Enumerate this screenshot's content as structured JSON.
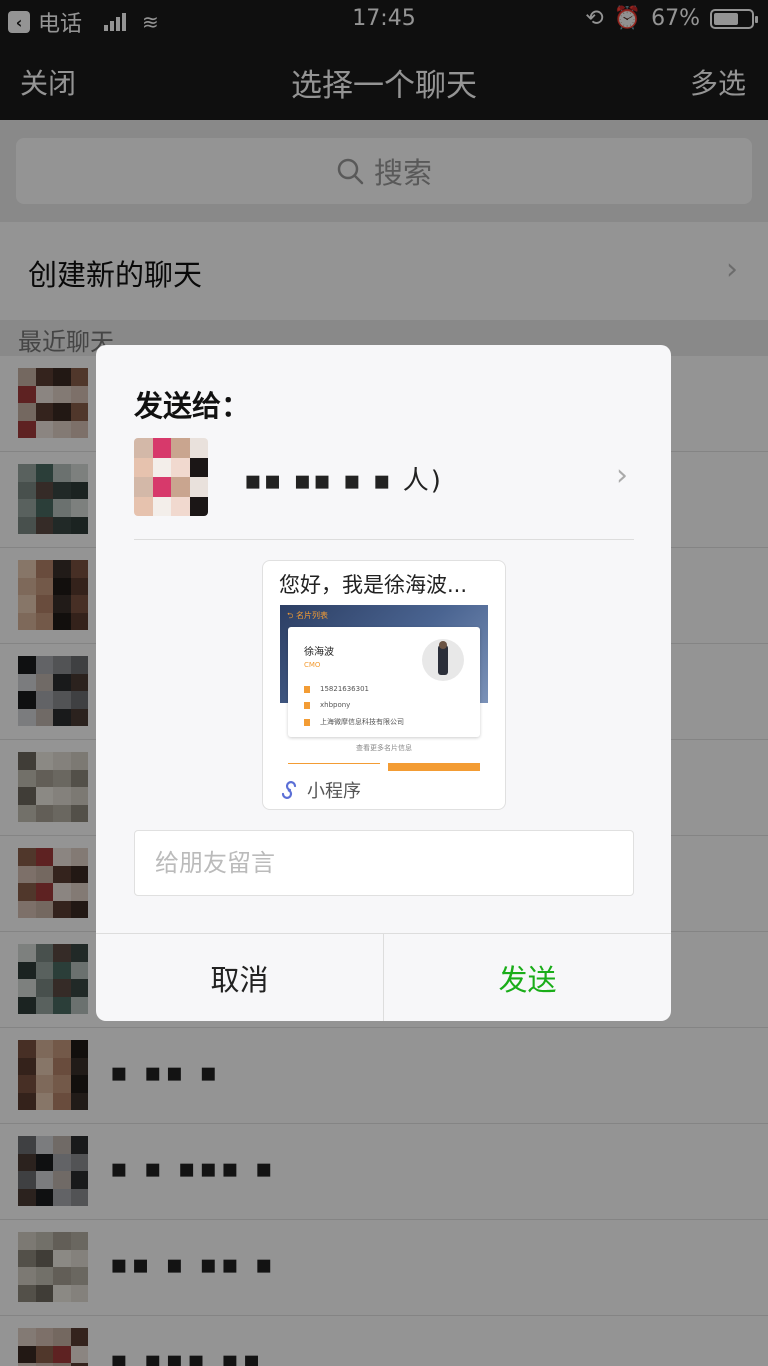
{
  "status_bar": {
    "carrier": "电话",
    "time": "17:45",
    "battery_percent": "67%",
    "battery_level": 0.67
  },
  "nav": {
    "close_label": "关闭",
    "title": "选择一个聊天",
    "multi_select_label": "多选"
  },
  "search": {
    "placeholder": "搜索"
  },
  "new_chat": {
    "label": "创建新的聊天"
  },
  "recent_section": {
    "label": "最近聊天"
  },
  "dialog": {
    "heading": "发送给：",
    "recipient_name_visible": "人)",
    "card": {
      "title": "您好，我是徐海波...",
      "preview": {
        "tag": "名片列表",
        "name": "徐海波",
        "job_title": "CMO",
        "phone": "15821636301",
        "wechat": "xhbpony",
        "company": "上海微摩信息科技有限公司",
        "more_link": "查看更多名片信息"
      },
      "source_label": "小程序"
    },
    "message_placeholder": "给朋友留言",
    "cancel_label": "取消",
    "send_label": "发送"
  },
  "colors": {
    "send_green": "#1aad19",
    "nav_background": "#1a1a1a",
    "accent_orange": "#f39c34"
  }
}
